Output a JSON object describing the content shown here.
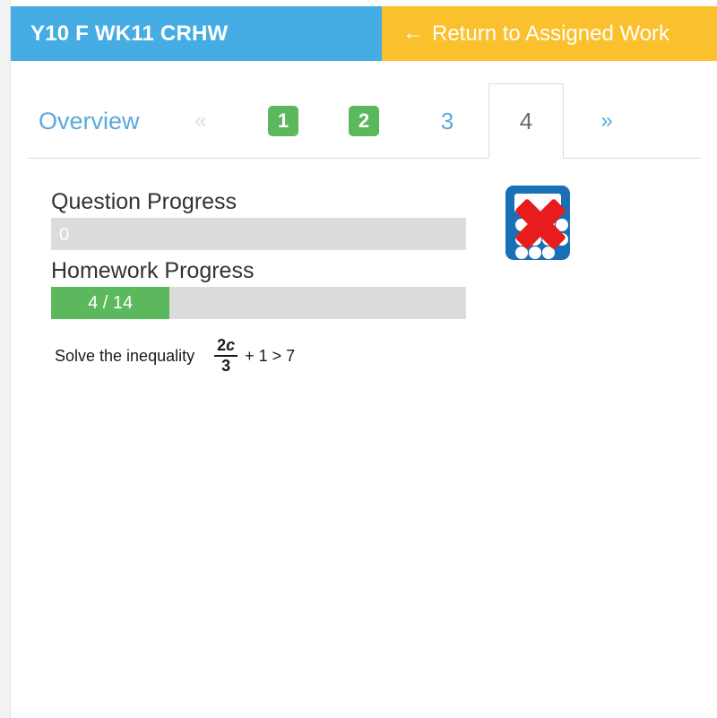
{
  "topbar": {
    "title": "Y10 F WK11 CRHW",
    "return_label": "Return to Assigned Work",
    "return_arrow": "←",
    "blue": "#46ace4",
    "yellow": "#fbc02d"
  },
  "tabs": {
    "overview_label": "Overview",
    "prev_label": "«",
    "next_label": "»",
    "items": [
      {
        "label": "1",
        "state": "done"
      },
      {
        "label": "2",
        "state": "done"
      },
      {
        "label": "3",
        "state": "pending"
      },
      {
        "label": "4",
        "state": "active"
      }
    ],
    "done_color": "#5cb85c",
    "link_color": "#5ba8dd"
  },
  "progress": {
    "question": {
      "label": "Question Progress",
      "value_text": "0",
      "percent": 0
    },
    "homework": {
      "label": "Homework Progress",
      "value_text": "4 / 14",
      "percent": 28.57,
      "completed": 4,
      "total": 14
    },
    "fill_color": "#5cb85c",
    "track_color": "#dcdcdc"
  },
  "question": {
    "prompt": "Solve the inequality",
    "fraction_numerator_coefficient": "2",
    "fraction_numerator_variable": "c",
    "fraction_denominator": "3",
    "expression_tail": "+ 1 > 7"
  },
  "calculator": {
    "icon_name": "calculator-not-allowed-icon",
    "body_color": "#1a6fb5",
    "cross_color": "#e81c1c"
  }
}
